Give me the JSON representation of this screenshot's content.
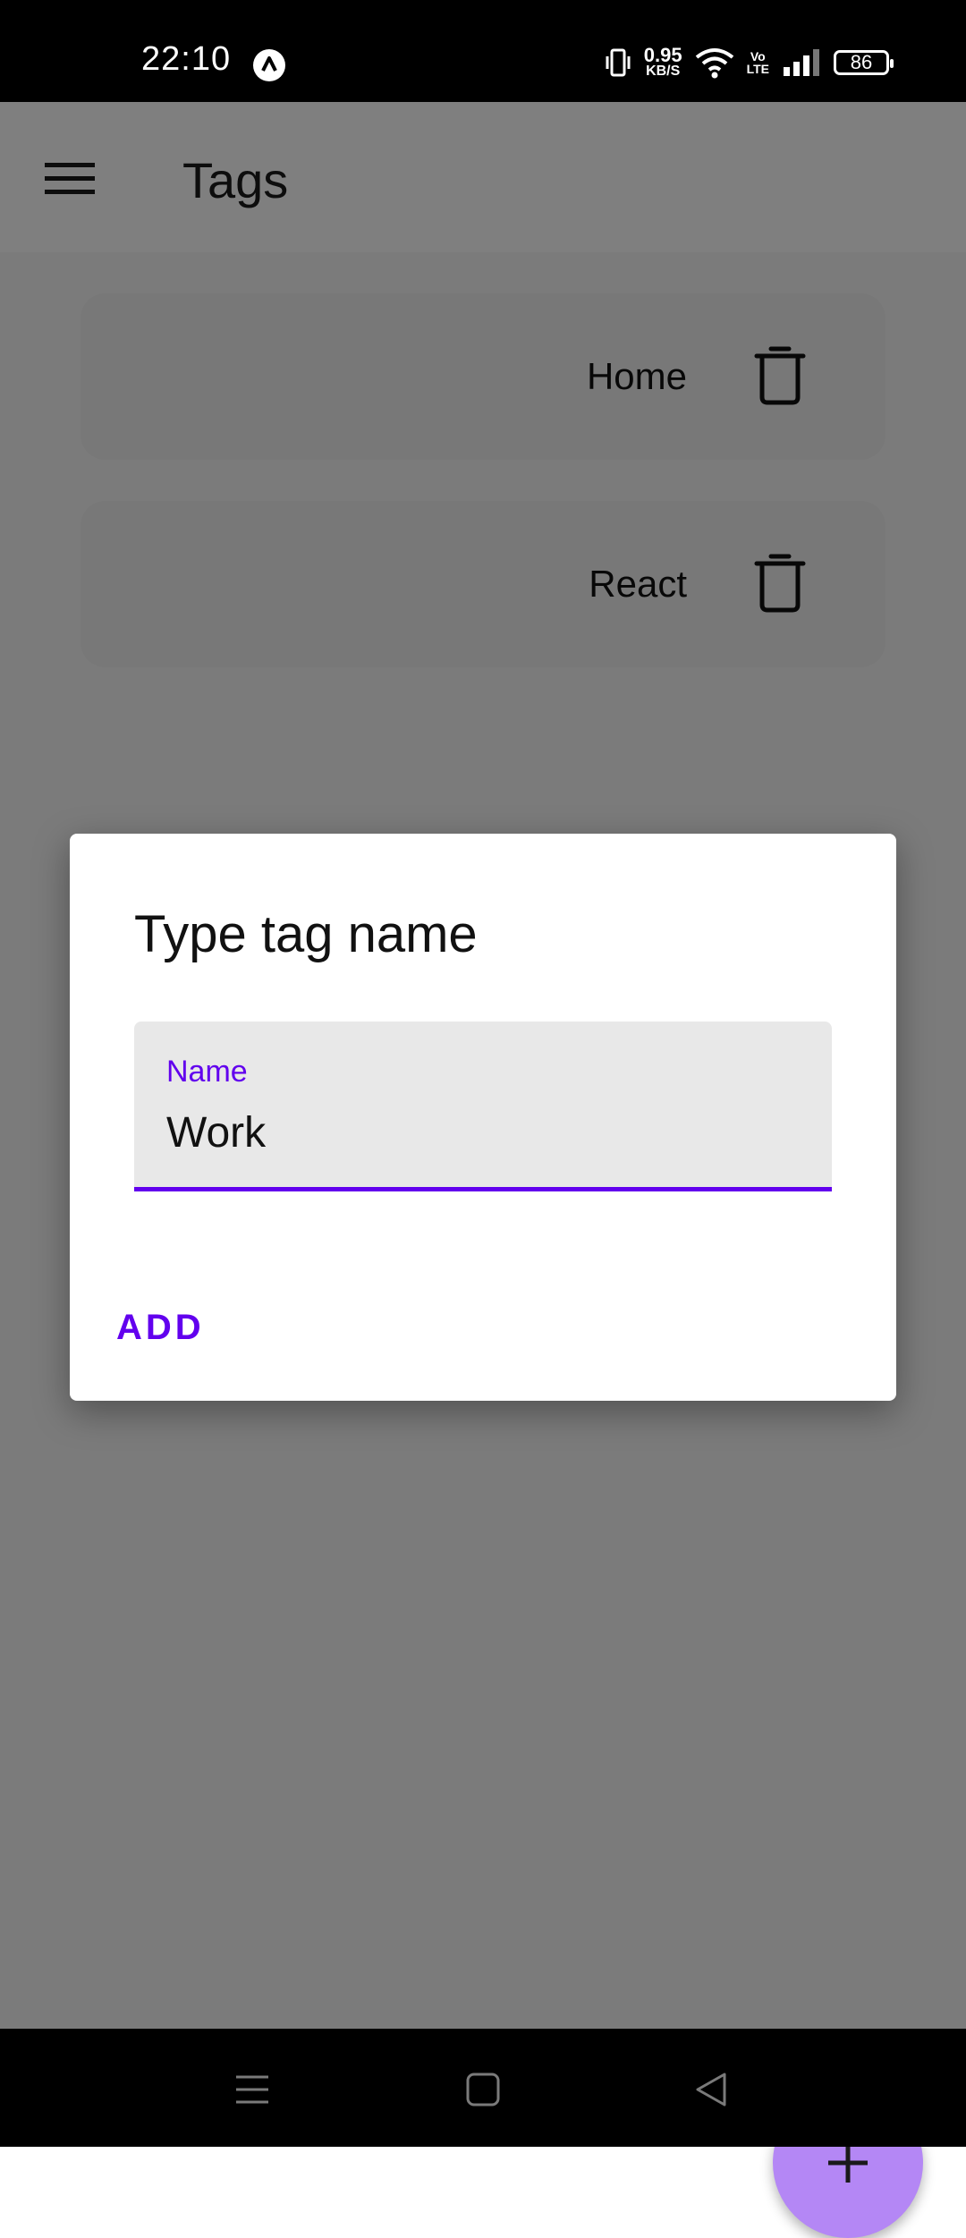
{
  "status_bar": {
    "time": "22:10",
    "app_icon": "caret-up-circle-icon",
    "vibrate_icon": "vibrate-icon",
    "net_speed_value": "0.95",
    "net_speed_unit": "KB/S",
    "wifi_icon": "wifi-icon",
    "volte_top": "Vo",
    "volte_bottom": "LTE",
    "signal_icon": "signal-bars-icon",
    "battery_level": "86"
  },
  "app_bar": {
    "menu_icon": "hamburger-menu-icon",
    "title": "Tags"
  },
  "tags": [
    {
      "label": "Home",
      "delete_icon": "trash-icon"
    },
    {
      "label": "React",
      "delete_icon": "trash-icon"
    }
  ],
  "fab": {
    "icon": "plus-icon",
    "color": "#b487f5"
  },
  "dialog": {
    "title": "Type tag name",
    "field": {
      "label": "Name",
      "value": "Work"
    },
    "add_label": "ADD",
    "accent_color": "#6200ee"
  },
  "nav_bar": {
    "menu_icon": "recent-apps-icon",
    "home_icon": "home-square-icon",
    "back_icon": "back-triangle-icon"
  }
}
